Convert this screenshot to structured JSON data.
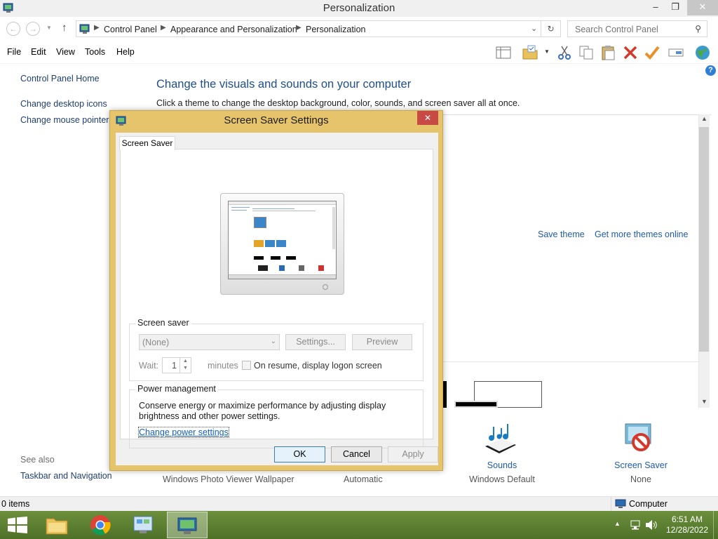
{
  "window": {
    "title": "Personalization",
    "minimize": "–",
    "restore": "❐",
    "close": "✕"
  },
  "address": {
    "crumbs": [
      "Control Panel",
      "Appearance and Personalization",
      "Personalization"
    ],
    "search_placeholder": "Search Control Panel"
  },
  "menu": [
    "File",
    "Edit",
    "View",
    "Tools",
    "Help"
  ],
  "sidebar": {
    "home": "Control Panel Home",
    "items": [
      "Change desktop icons",
      "Change mouse pointers"
    ],
    "see_also_header": "See also",
    "see_also": [
      "Taskbar and Navigation"
    ]
  },
  "main": {
    "heading": "Change the visuals and sounds on your computer",
    "subtitle": "Click a theme to change the desktop background, color, sounds, and screen saver all at once.",
    "save_theme": "Save theme",
    "get_more_themes": "Get more themes online"
  },
  "bottom_bar": {
    "desktop_background_value": "Windows Photo Viewer Wallpaper",
    "color_value": "Automatic",
    "sounds_label": "Sounds",
    "sounds_value": "Windows Default",
    "screensaver_label": "Screen Saver",
    "screensaver_value": "None"
  },
  "status": {
    "items": "0 items",
    "location": "Computer"
  },
  "taskbar": {
    "time": "6:51 AM",
    "date": "12/28/2022"
  },
  "dialog": {
    "title": "Screen Saver Settings",
    "close": "✕",
    "tab": "Screen Saver",
    "screensaver_group": "Screen saver",
    "screensaver_selected": "(None)",
    "settings_button": "Settings...",
    "preview_button": "Preview",
    "wait_label": "Wait:",
    "wait_value": "1",
    "minutes_label": "minutes",
    "resume_label": "On resume, display logon screen",
    "power_group": "Power management",
    "power_text_1": "Conserve energy or maximize performance by adjusting display",
    "power_text_2": "brightness and other power settings.",
    "power_link": "Change power settings",
    "ok": "OK",
    "cancel": "Cancel",
    "apply": "Apply"
  }
}
